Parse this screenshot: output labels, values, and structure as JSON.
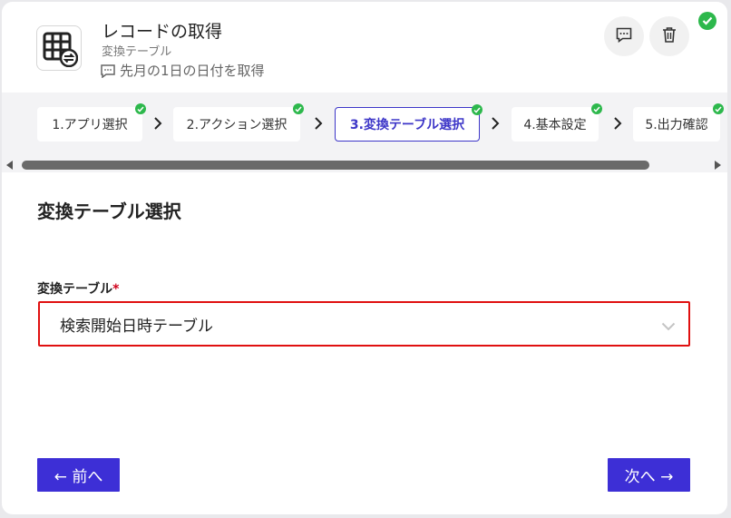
{
  "header": {
    "title": "レコードの取得",
    "subtitle": "変換テーブル",
    "memo": "先月の1日の日付を取得",
    "app_icon": "table-sync-icon",
    "comment_icon": "comment-icon",
    "trash_icon": "trash-icon",
    "status_icon": "check-circle-icon",
    "status_color": "#2db84c"
  },
  "steps": [
    {
      "label": "1.アプリ選択",
      "done": true
    },
    {
      "label": "2.アクション選択",
      "done": true
    },
    {
      "label": "3.変換テーブル選択",
      "done": true,
      "active": true
    },
    {
      "label": "4.基本設定",
      "done": true
    },
    {
      "label": "5.出力確認",
      "done": true
    }
  ],
  "section": {
    "title": "変換テーブル選択"
  },
  "field": {
    "label": "変換テーブル",
    "required_mark": "*",
    "value": "検索開始日時テーブル"
  },
  "nav": {
    "prev_label": "← 前へ",
    "next_label": "次へ →"
  },
  "colors": {
    "accent": "#3d2fd6",
    "error_border": "#e01010",
    "success": "#2db84c"
  }
}
